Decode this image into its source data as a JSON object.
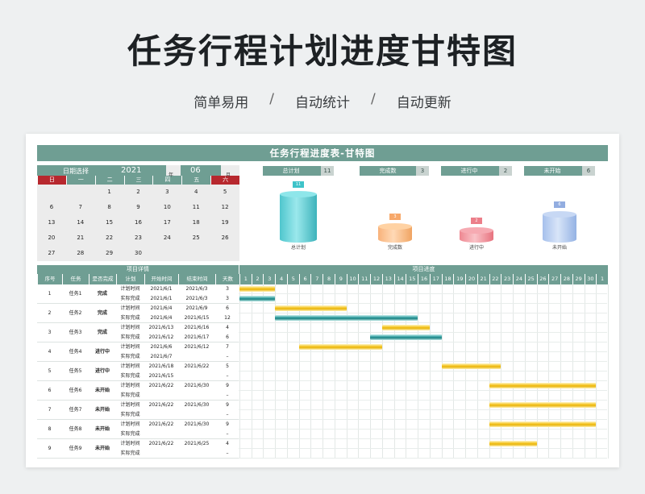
{
  "headline": "任务行程计划进度甘特图",
  "subline": [
    "简单易用",
    "/",
    "自动统计",
    "/",
    "自动更新"
  ],
  "sheet": {
    "banner": "任务行程进度表-甘特图",
    "calendar": {
      "label": "日期选择",
      "year": "2021",
      "year_suffix": "年",
      "month": "06",
      "month_suffix": "月",
      "weekdays": [
        "日",
        "一",
        "二",
        "三",
        "四",
        "五",
        "六"
      ],
      "days": [
        [
          "",
          "",
          "1",
          "2",
          "3",
          "4",
          "5"
        ],
        [
          "6",
          "7",
          "8",
          "9",
          "10",
          "11",
          "12"
        ],
        [
          "13",
          "14",
          "15",
          "16",
          "17",
          "18",
          "19"
        ],
        [
          "20",
          "21",
          "22",
          "23",
          "24",
          "25",
          "26"
        ],
        [
          "27",
          "28",
          "29",
          "30",
          "",
          "",
          ""
        ]
      ]
    },
    "stats": [
      {
        "title": "总计划",
        "value": "11",
        "tag": "11",
        "caption": "总计划"
      },
      {
        "title": "完成数",
        "value": "3",
        "tag": "3",
        "caption": "完成数"
      },
      {
        "title": "进行中",
        "value": "2",
        "tag": "2",
        "caption": "进行中"
      },
      {
        "title": "未开始",
        "value": "6",
        "tag": "6",
        "caption": "未开始"
      }
    ],
    "table": {
      "section_detail": "项目详情",
      "section_progress": "项目进度",
      "headers": [
        "序号",
        "任务",
        "是否完成",
        "计划",
        "开始时间",
        "结束时间",
        "天数"
      ],
      "day_numbers": [
        "1",
        "2",
        "3",
        "4",
        "5",
        "6",
        "7",
        "8",
        "9",
        "10",
        "11",
        "12",
        "13",
        "14",
        "15",
        "16",
        "17",
        "18",
        "19",
        "20",
        "21",
        "22",
        "23",
        "24",
        "25",
        "26",
        "27",
        "28",
        "29",
        "30",
        "1"
      ],
      "tasks": [
        {
          "no": "1",
          "name": "任务1",
          "status": "完成",
          "plan_label": "计划时间",
          "act_label": "实际完成",
          "plan_start": "2021/6/1",
          "plan_end": "2021/6/3",
          "plan_days": "3",
          "act_start": "2021/6/1",
          "act_end": "2021/6/3",
          "act_days": "3",
          "plan_bar": [
            1,
            3
          ],
          "act_bar": [
            1,
            3
          ]
        },
        {
          "no": "2",
          "name": "任务2",
          "status": "完成",
          "plan_label": "计划时间",
          "act_label": "实际完成",
          "plan_start": "2021/6/4",
          "plan_end": "2021/6/9",
          "plan_days": "6",
          "act_start": "2021/6/4",
          "act_end": "2021/6/15",
          "act_days": "12",
          "plan_bar": [
            4,
            9
          ],
          "act_bar": [
            4,
            15
          ]
        },
        {
          "no": "3",
          "name": "任务3",
          "status": "完成",
          "plan_label": "计划时间",
          "act_label": "实际完成",
          "plan_start": "2021/6/13",
          "plan_end": "2021/6/16",
          "plan_days": "4",
          "act_start": "2021/6/12",
          "act_end": "2021/6/17",
          "act_days": "6",
          "plan_bar": [
            13,
            16
          ],
          "act_bar": [
            12,
            17
          ]
        },
        {
          "no": "4",
          "name": "任务4",
          "status": "进行中",
          "plan_label": "计划时间",
          "act_label": "实际完成",
          "plan_start": "2021/6/6",
          "plan_end": "2021/6/12",
          "plan_days": "7",
          "act_start": "2021/6/7",
          "act_end": "",
          "act_days": "–",
          "plan_bar": [
            6,
            12
          ],
          "act_bar": null
        },
        {
          "no": "5",
          "name": "任务5",
          "status": "进行中",
          "plan_label": "计划时间",
          "act_label": "实际完成",
          "plan_start": "2021/6/18",
          "plan_end": "2021/6/22",
          "plan_days": "5",
          "act_start": "2021/6/15",
          "act_end": "",
          "act_days": "–",
          "plan_bar": [
            18,
            22
          ],
          "act_bar": null
        },
        {
          "no": "6",
          "name": "任务6",
          "status": "未开始",
          "plan_label": "计划时间",
          "act_label": "实际完成",
          "plan_start": "2021/6/22",
          "plan_end": "2021/6/30",
          "plan_days": "9",
          "act_start": "",
          "act_end": "",
          "act_days": "–",
          "plan_bar": [
            22,
            30
          ],
          "act_bar": null
        },
        {
          "no": "7",
          "name": "任务7",
          "status": "未开始",
          "plan_label": "计划时间",
          "act_label": "实际完成",
          "plan_start": "2021/6/22",
          "plan_end": "2021/6/30",
          "plan_days": "9",
          "act_start": "",
          "act_end": "",
          "act_days": "–",
          "plan_bar": [
            22,
            30
          ],
          "act_bar": null
        },
        {
          "no": "8",
          "name": "任务8",
          "status": "未开始",
          "plan_label": "计划时间",
          "act_label": "实际完成",
          "plan_start": "2021/6/22",
          "plan_end": "2021/6/30",
          "plan_days": "9",
          "act_start": "",
          "act_end": "",
          "act_days": "–",
          "plan_bar": [
            22,
            30
          ],
          "act_bar": null
        },
        {
          "no": "9",
          "name": "任务9",
          "status": "未开始",
          "plan_label": "计划时间",
          "act_label": "实际完成",
          "plan_start": "2021/6/22",
          "plan_end": "2021/6/25",
          "plan_days": "4",
          "act_start": "",
          "act_end": "",
          "act_days": "–",
          "plan_bar": [
            22,
            25
          ],
          "act_bar": null
        }
      ]
    }
  },
  "colors": {
    "header": "#6f9e93",
    "weekend": "#b7282e",
    "plan_bar": "#f3c21d",
    "actual_bar": "#2c9a9c"
  }
}
